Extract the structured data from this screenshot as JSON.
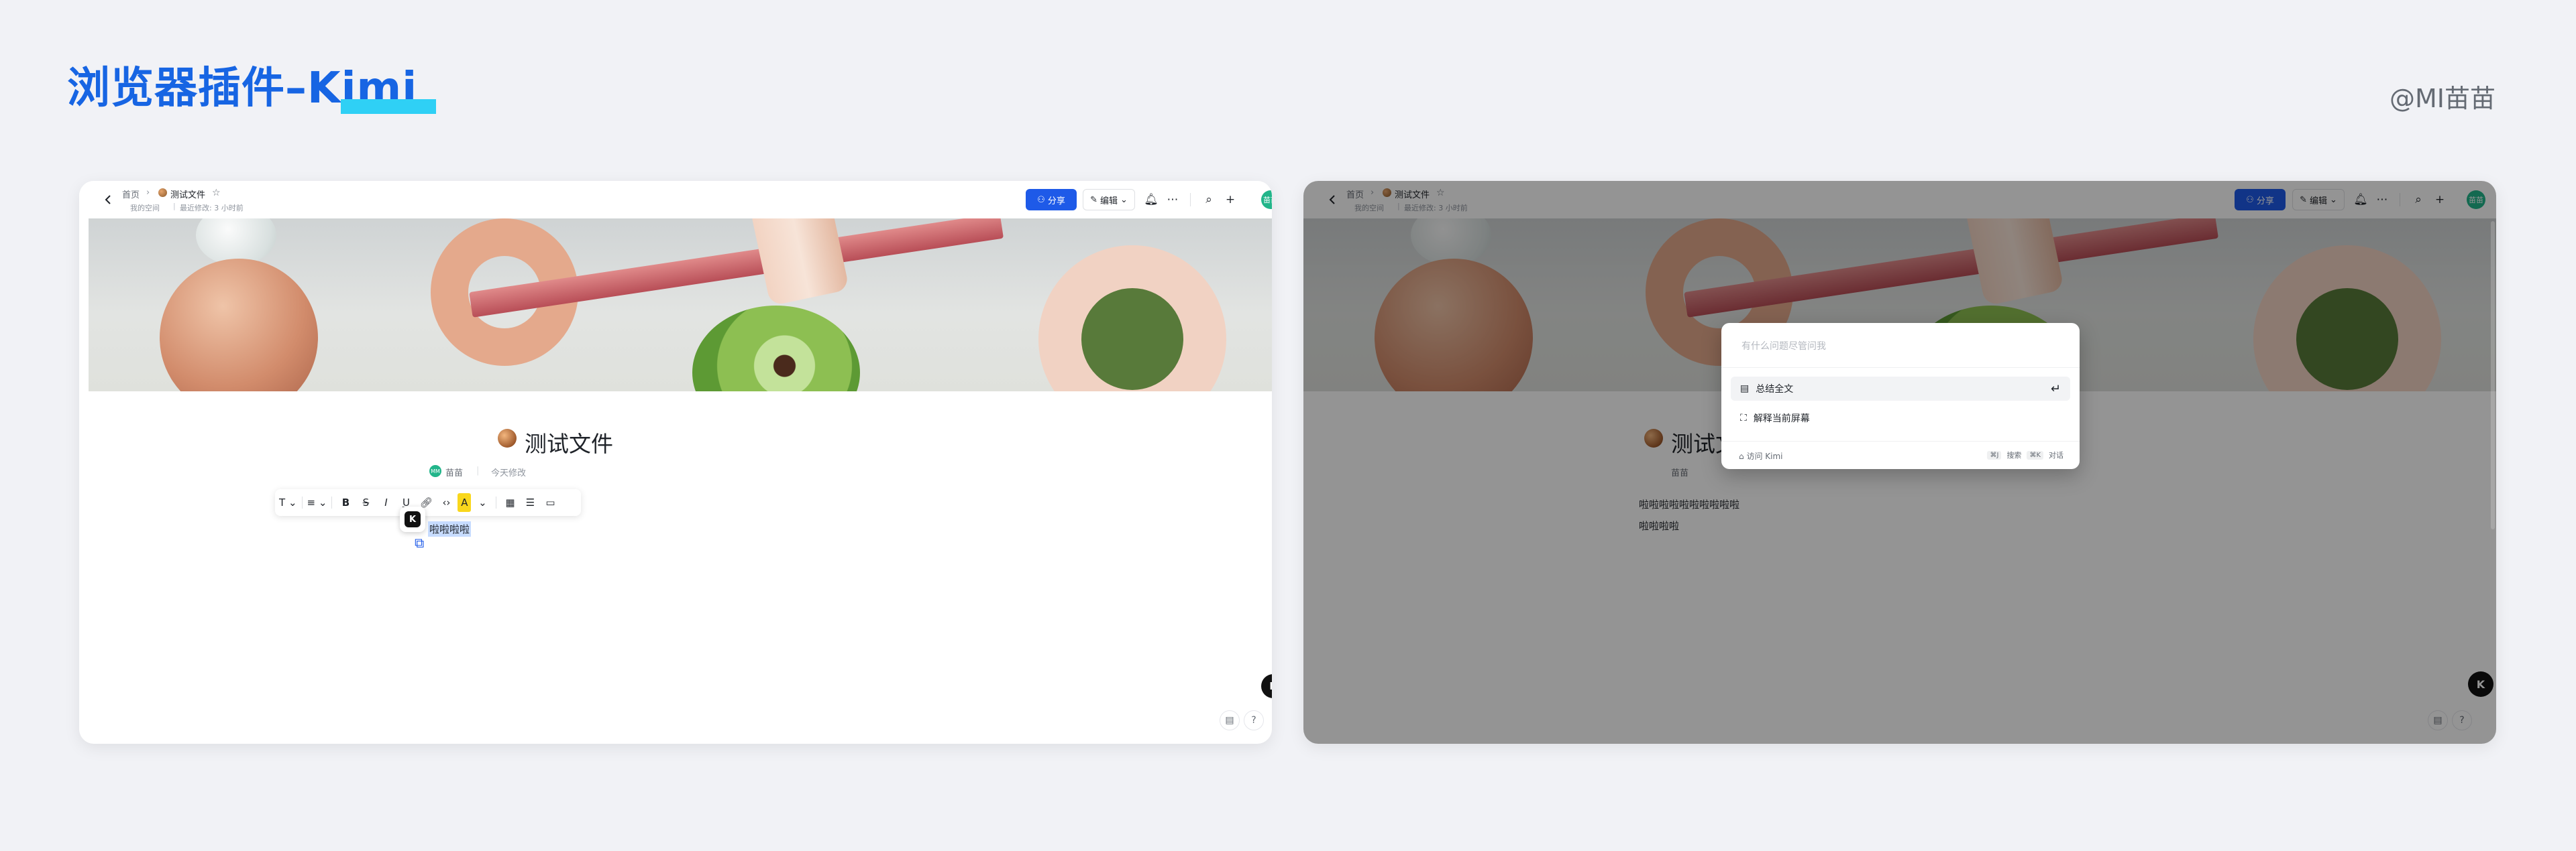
{
  "header": {
    "title": "浏览器插件–Kimi",
    "author": "@MI苗苗"
  },
  "topbar": {
    "breadcrumb_home": "首页",
    "breadcrumb_separator": "›",
    "breadcrumb_doc": "测试文件",
    "location": "我的空间",
    "location_separator": "|",
    "last_modified": "最近修改: 3 小时前",
    "share_label": "分享",
    "edit_label": "编辑",
    "avatar_text": "苗苗"
  },
  "document": {
    "title": "测试文件",
    "owner": "苗苗",
    "owner_separator": "|",
    "modified": "今天修改",
    "selected_text": "啦啦啦啦",
    "line1": "啦啦啦啦啦啦啦啦啦啦",
    "line2": "啦啦啦啦"
  },
  "toolbar": {
    "text_style": "T",
    "align": "≡",
    "bold": "B",
    "strike": "S",
    "italic": "I",
    "underline": "U",
    "highlight": "A"
  },
  "kimi": {
    "badge": "K",
    "dialog": {
      "placeholder": "有什么问题尽管问我",
      "actions": [
        {
          "label": "总结全文"
        },
        {
          "label": "解释当前屏幕"
        }
      ],
      "footer_visit": "访问 Kimi",
      "shortcut_search_key": "⌘J",
      "shortcut_search_label": "搜索",
      "shortcut_chat_key": "⌘K",
      "shortcut_chat_label": "对话"
    }
  },
  "colors": {
    "title_blue": "#1765e3",
    "title_accent": "#2fd0f5",
    "share_blue": "#1e5ae8",
    "avatar_green": "#22b58a"
  }
}
